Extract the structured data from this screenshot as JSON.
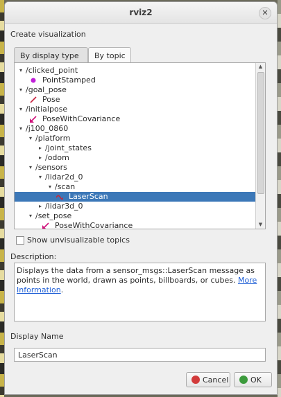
{
  "window": {
    "title": "rviz2",
    "close_glyph": "✕"
  },
  "dialog": {
    "header": "Create visualization",
    "tabs": [
      {
        "label": "By display type",
        "active": false
      },
      {
        "label": "By topic",
        "active": true
      }
    ],
    "tree": [
      {
        "label": "/clicked_point",
        "icon": "chevron-down-icon"
      },
      {
        "label": "PointStamped",
        "icon": "point-stamped-icon",
        "icon_color": "#c020d8"
      },
      {
        "label": "/goal_pose",
        "icon": "chevron-down-icon"
      },
      {
        "label": "Pose",
        "icon": "pose-arrow-icon",
        "icon_color": "#c81e3c"
      },
      {
        "label": "/initialpose",
        "icon": "chevron-down-icon"
      },
      {
        "label": "PoseWithCovariance",
        "icon": "pose-covariance-icon",
        "icon_color": "#d0127a"
      },
      {
        "label": "/j100_0860",
        "icon": "chevron-down-icon"
      },
      {
        "label": "/platform",
        "icon": "chevron-down-icon"
      },
      {
        "label": "/joint_states",
        "icon": "chevron-right-icon"
      },
      {
        "label": "/odom",
        "icon": "chevron-right-icon"
      },
      {
        "label": "/sensors",
        "icon": "chevron-down-icon"
      },
      {
        "label": "/lidar2d_0",
        "icon": "chevron-down-icon"
      },
      {
        "label": "/scan",
        "icon": "chevron-down-icon"
      },
      {
        "label": "LaserScan",
        "icon": "laserscan-icon",
        "icon_color": "#d02030",
        "selected": true
      },
      {
        "label": "/lidar3d_0",
        "icon": "chevron-right-icon"
      },
      {
        "label": "/set_pose",
        "icon": "chevron-down-icon"
      },
      {
        "label": "PoseWithCovariance",
        "icon": "pose-covariance-icon",
        "icon_color": "#d0127a"
      }
    ],
    "show_unvisualizable": {
      "label": "Show unvisualizable topics",
      "checked": false
    },
    "description": {
      "header": "Description:",
      "text": "Displays the data from a sensor_msgs::LaserScan message as points in the world, drawn as points, billboards, or cubes.",
      "link": "More Information",
      "tail": "."
    },
    "display_name": {
      "header": "Display Name",
      "value": "LaserScan"
    },
    "buttons": {
      "cancel": "Cancel",
      "ok": "OK",
      "cancel_color": "#d23b3b",
      "ok_color": "#3c9b3c"
    }
  }
}
